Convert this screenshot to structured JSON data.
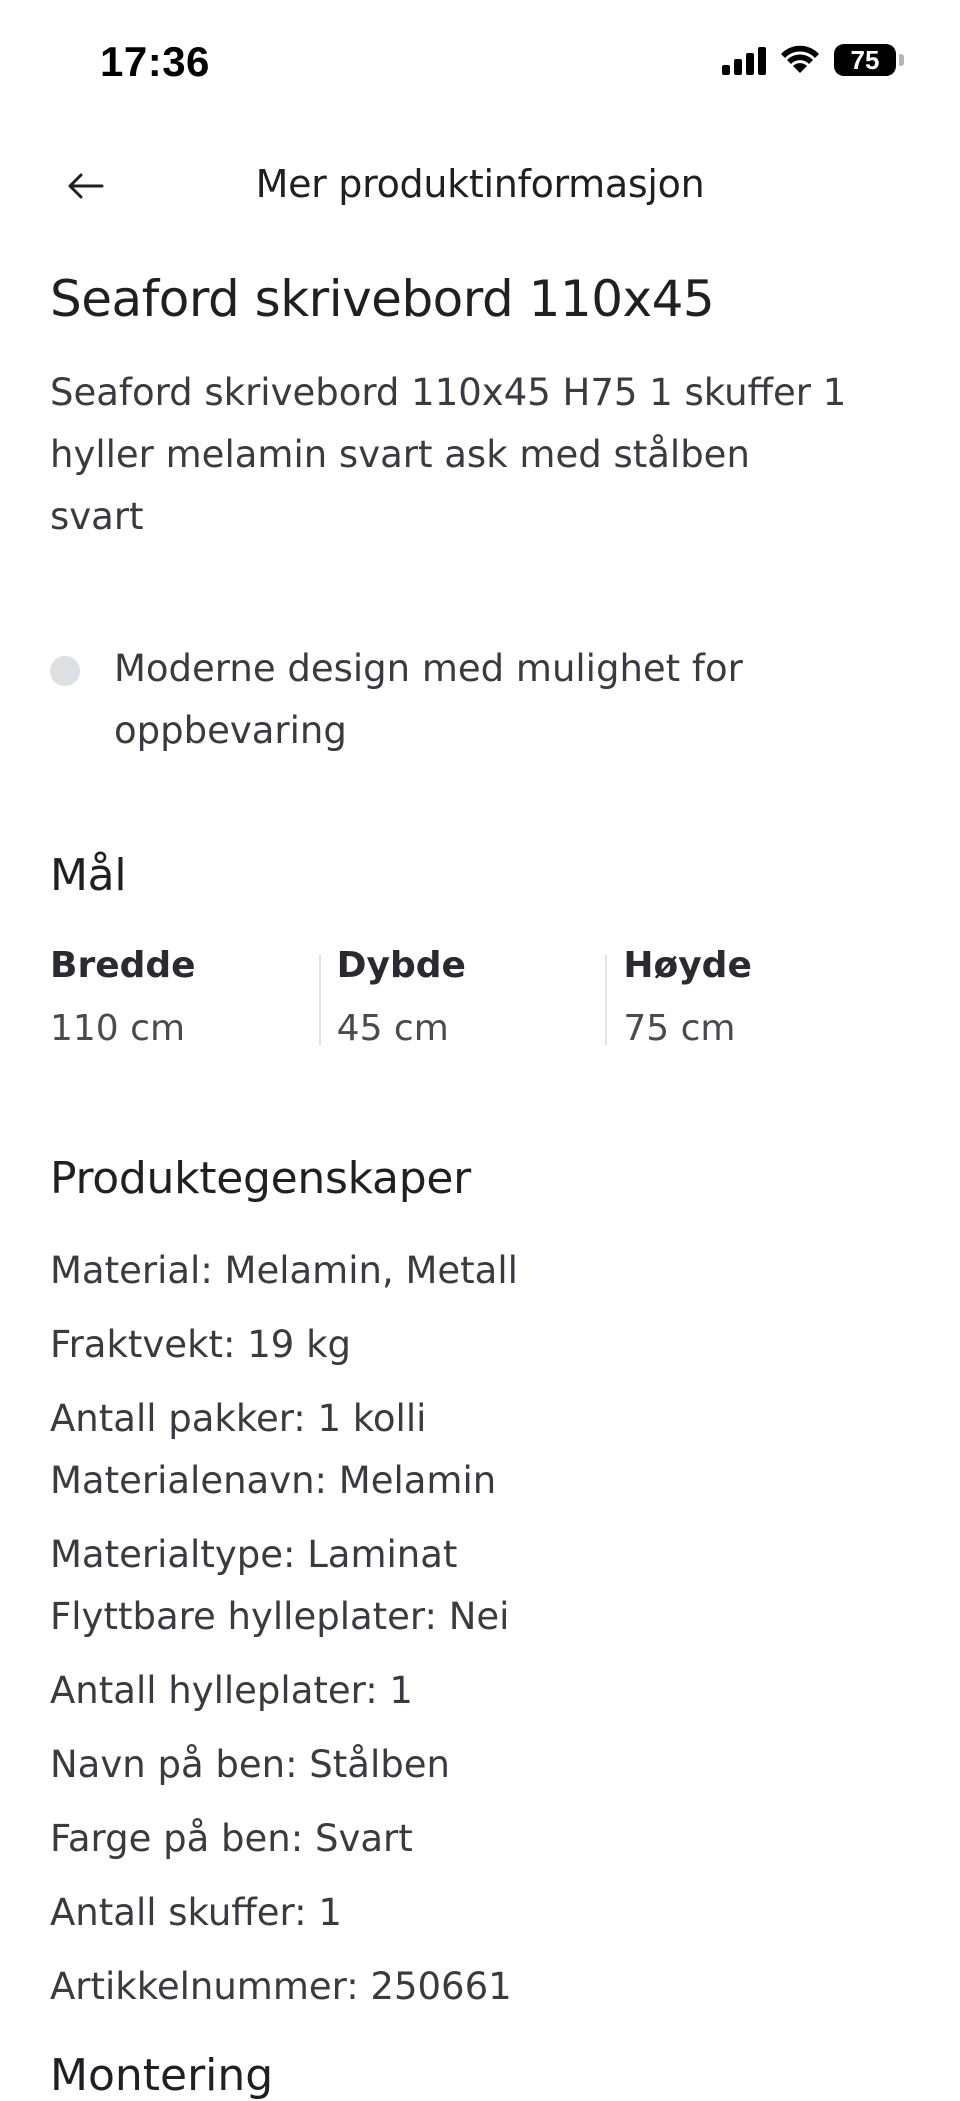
{
  "status_bar": {
    "time": "17:36",
    "battery": "75",
    "icons": [
      "signal-icon",
      "wifi-icon",
      "battery-icon"
    ]
  },
  "header": {
    "title": "Mer produktinformasjon",
    "back_icon": "arrow-left-icon"
  },
  "product": {
    "title": "Seaford skrivebord 110x45",
    "description": "Seaford skrivebord 110x45 H75 1 skuffer 1 hyller melamin svart ask med stålben svart",
    "bullets": [
      "Moderne design med mulighet for oppbevaring"
    ]
  },
  "dimensions": {
    "title": "Mål",
    "items": [
      {
        "label": "Bredde",
        "value": "110 cm"
      },
      {
        "label": "Dybde",
        "value": "45 cm"
      },
      {
        "label": "Høyde",
        "value": "75 cm"
      }
    ]
  },
  "properties": {
    "title": "Produktegenskaper",
    "items": [
      "Material: Melamin, Metall",
      "Fraktvekt: 19 kg",
      "Antall pakker: 1 kolli",
      "Materialenavn: Melamin",
      "Materialtype: Laminat",
      "Flyttbare hylleplater: Nei",
      "Antall hylleplater: 1",
      "Navn på ben: Stålben",
      "Farge på ben: Svart",
      "Antall skuffer: 1",
      "Artikkelnummer: 250661"
    ]
  },
  "next_section_title": "Montering",
  "colors": {
    "text": "#1f1f24",
    "secondary_text": "#3a3a40",
    "bullet": "#dde0e2",
    "divider": "#e3e3e6"
  }
}
